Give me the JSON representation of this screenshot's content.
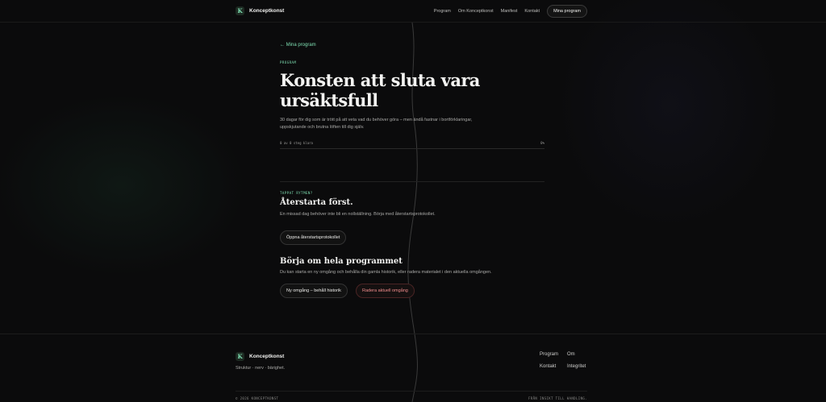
{
  "header": {
    "brand_mark": "K",
    "brand_name": "Konceptkonst",
    "nav": [
      "Program",
      "Om Konceptkonst",
      "Manifest",
      "Kontakt"
    ],
    "cta": "Mina program"
  },
  "main": {
    "back_link": "← Mina program",
    "eyebrow": "PROGRAM",
    "title_line1": "Konsten att sluta vara",
    "title_line2": "ursäktsfull",
    "description_line1": "30 dagar för dig som är trött på att veta vad du behöver göra – men ändå fastnar i bortförklaringar,",
    "description_line2": "uppskjutande och brutna löften till dig själv.",
    "progress_label": "0 av 0 steg klara",
    "progress_pct": "0%",
    "progress_value": 0
  },
  "restart": {
    "eyebrow": "TAPPAT RYTMEN?",
    "title": "Återstarta först.",
    "text": "En missad dag behöver inte bli en nollställning. Börja med återstartsprotokollet.",
    "button": "Öppna återstartsprotokollet"
  },
  "reset": {
    "title": "Börja om hela programmet",
    "text": "Du kan starta en ny omgång och behålla din gamla historik, eller radera materialet i den aktuella omgången.",
    "button_new": "Ny omgång – behåll historik",
    "button_delete": "Radera aktuell omgång"
  },
  "footer": {
    "brand_mark": "K",
    "brand_name": "Konceptkonst",
    "tagline": "Struktur · nerv · bärighet.",
    "links_col1": [
      "Program",
      "Kontakt"
    ],
    "links_col2": [
      "Om",
      "Integritet"
    ],
    "copyright": "© 2026 KONCEPTKONST",
    "motto": "FRÅN INSIKT TILL HANDLING."
  },
  "colors": {
    "accent": "#7fe0b3",
    "danger": "#f08c8c",
    "background": "#0b0b0c"
  }
}
